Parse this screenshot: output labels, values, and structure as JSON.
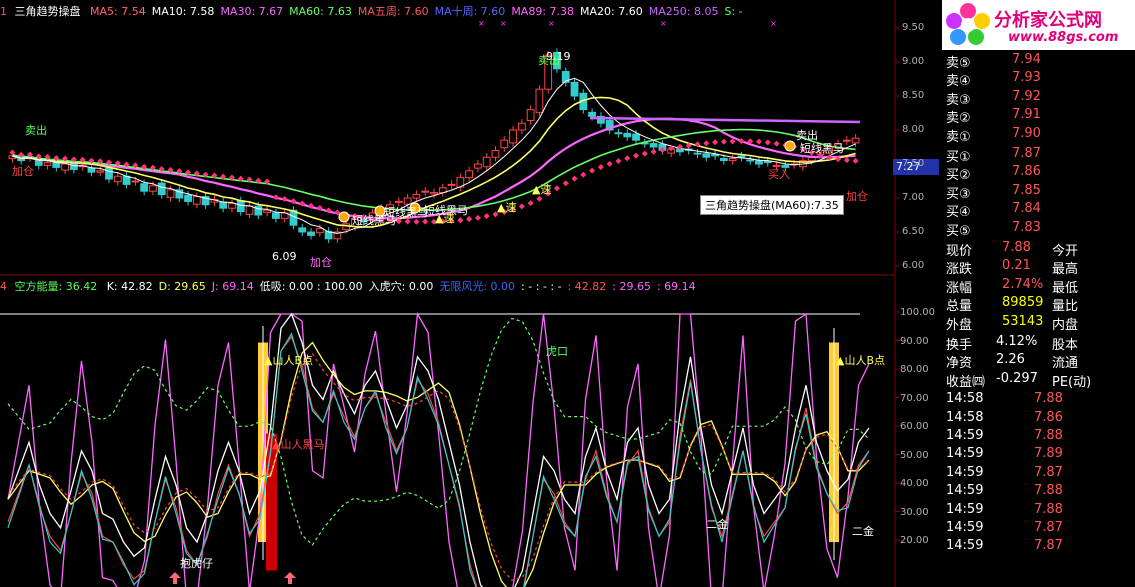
{
  "main": {
    "prefix": "1",
    "title": "三角趋势操盘",
    "ma": [
      {
        "label": "MA5: 7.54",
        "color": "#ff6666"
      },
      {
        "label": "MA10: 7.58",
        "color": "#ffffff"
      },
      {
        "label": "MA30: 7.67",
        "color": "#ff66ff"
      },
      {
        "label": "MA60: 7.63",
        "color": "#66ff66"
      },
      {
        "label": "MA五周: 7.60",
        "color": "#ff5555"
      },
      {
        "label": "MA十周: 7.60",
        "color": "#5566ff"
      },
      {
        "label": "MA89: 7.38",
        "color": "#ff66ff"
      },
      {
        "label": "MA20: 7.60",
        "color": "#ffffff"
      },
      {
        "label": "MA250: 8.05",
        "color": "#cc66ff"
      },
      {
        "label": "S: -",
        "color": "#66ff66"
      }
    ],
    "tooltip": "三角趋势操盘(MA60):7.35",
    "price_cursor": "7.27",
    "y_ticks": [
      "9.50",
      "9.00",
      "8.50",
      "8.00",
      "7.50",
      "7.00",
      "6.50",
      "6.00"
    ],
    "labels": {
      "sell_out_1": "卖出",
      "sell_out_2": "卖出",
      "sell_out_3": "卖出",
      "peak": "9.19",
      "low": "6.09",
      "add_pos_1": "加仓",
      "add_pos_2": "加仓",
      "short_blackhorse_1": "短线黑马",
      "short_blackhorse_2": "短线黑马",
      "short_blackhorse_3": "短线黑马",
      "short_blackhorse_4": "短线黑马",
      "speed_1": "▲速",
      "speed_2": "▲速",
      "speed_3": "▲速",
      "speed_4": "▲速",
      "buy_in": "买入",
      "left_mark": "加仓"
    }
  },
  "sub": {
    "prefix": "4",
    "title": "空方能量: 36.42",
    "values": [
      {
        "label": "K: 42.82",
        "color": "#ffffff"
      },
      {
        "label": "D: 29.65",
        "color": "#ffff55"
      },
      {
        "label": "J: 69.14",
        "color": "#ff66ff"
      },
      {
        "label": "低吸: 0.00 : 100.00",
        "color": "#ffffff"
      },
      {
        "label": "入虎穴: 0.00",
        "color": "#ffffff"
      },
      {
        "label": "无限风光: 0.00",
        "color": "#3366ff"
      },
      {
        "label": ": - : - : -",
        "color": "#ffffff"
      },
      {
        "label": ": 42.82",
        "color": "#ff5555"
      },
      {
        "label": ": 29.65",
        "color": "#ff66ff"
      },
      {
        "label": ": 69.14",
        "color": "#ff66ff"
      }
    ],
    "y_ticks": [
      "100.00",
      "90.00",
      "80.00",
      "70.00",
      "60.00",
      "50.00",
      "40.00",
      "30.00",
      "20.00"
    ],
    "labels": {
      "tiger_cub": "抱虎仔",
      "b_point_1": "▲山人B点",
      "b_point_2": "▲山人B点",
      "black_horse": "▲山人黑马",
      "tiger_mouth": "虎口",
      "gold_1": "二金",
      "gold_2": "二金"
    }
  },
  "logo": {
    "text": "分析家公式网",
    "url": "www.88gs.com"
  },
  "quote": {
    "asks": [
      {
        "label": "卖⑤",
        "price": "7.94"
      },
      {
        "label": "卖④",
        "price": "7.93"
      },
      {
        "label": "卖③",
        "price": "7.92"
      },
      {
        "label": "卖②",
        "price": "7.91"
      },
      {
        "label": "卖①",
        "price": "7.90"
      }
    ],
    "bids": [
      {
        "label": "买①",
        "price": "7.87"
      },
      {
        "label": "买②",
        "price": "7.86"
      },
      {
        "label": "买③",
        "price": "7.85"
      },
      {
        "label": "买④",
        "price": "7.84"
      },
      {
        "label": "买⑤",
        "price": "7.83"
      }
    ],
    "stats": [
      {
        "label": "现价",
        "value": "7.88",
        "right": "今开"
      },
      {
        "label": "涨跌",
        "value": "0.21",
        "right": "最高"
      },
      {
        "label": "涨幅",
        "value": "2.74%",
        "right": "最低"
      },
      {
        "label": "总量",
        "value": "89859",
        "right": "量比"
      },
      {
        "label": "外盘",
        "value": "53143",
        "right": "内盘"
      }
    ],
    "stats2": [
      {
        "label": "换手",
        "value": "4.12%",
        "right": "股本"
      },
      {
        "label": "净资",
        "value": "2.26",
        "right": "流通"
      },
      {
        "label": "收益㈣",
        "value": "-0.297",
        "right": "PE(动)"
      }
    ],
    "ticks": [
      {
        "time": "14:58",
        "price": "7.88"
      },
      {
        "time": "14:58",
        "price": "7.86"
      },
      {
        "time": "14:59",
        "price": "7.88"
      },
      {
        "time": "14:59",
        "price": "7.89"
      },
      {
        "time": "14:59",
        "price": "7.87"
      },
      {
        "time": "14:59",
        "price": "7.88"
      },
      {
        "time": "14:59",
        "price": "7.88"
      },
      {
        "time": "14:59",
        "price": "7.87"
      },
      {
        "time": "14:59",
        "price": "7.87"
      }
    ]
  },
  "colors": {
    "up": "#ff4444",
    "down": "#33cccc",
    "text_red": "#ff5555",
    "text_yellow": "#ffff00",
    "text_green": "#55ff55",
    "text_white": "#ffffff",
    "accent_blue": "#3333cc"
  }
}
